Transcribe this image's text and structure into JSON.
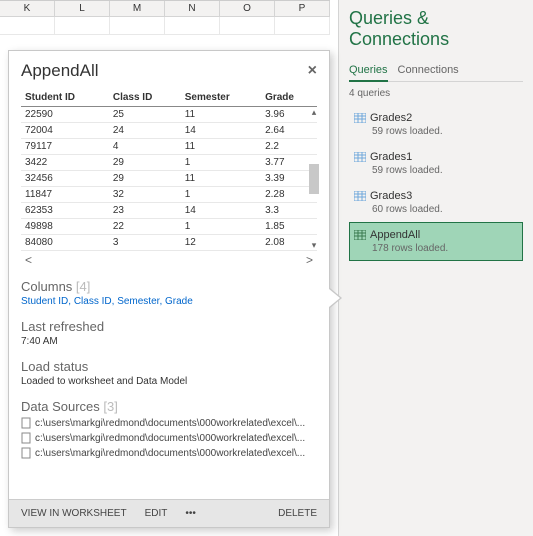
{
  "sheet": {
    "cols": [
      "K",
      "L",
      "M",
      "N",
      "O",
      "P"
    ]
  },
  "panel": {
    "title": "Queries & Connections",
    "tabs": {
      "queries": "Queries",
      "connections": "Connections"
    },
    "count": "4 queries",
    "items": [
      {
        "name": "Grades2",
        "sub": "59 rows loaded."
      },
      {
        "name": "Grades1",
        "sub": "59 rows loaded."
      },
      {
        "name": "Grades3",
        "sub": "60 rows loaded."
      },
      {
        "name": "AppendAll",
        "sub": "178 rows loaded."
      }
    ]
  },
  "popup": {
    "title": "AppendAll",
    "headers": [
      "Student ID",
      "Class ID",
      "Semester",
      "Grade"
    ],
    "rows": [
      [
        "22590",
        "25",
        "11",
        "3.96"
      ],
      [
        "72004",
        "24",
        "14",
        "2.64"
      ],
      [
        "79117",
        "4",
        "11",
        "2.2"
      ],
      [
        "3422",
        "29",
        "1",
        "3.77"
      ],
      [
        "32456",
        "29",
        "11",
        "3.39"
      ],
      [
        "11847",
        "32",
        "1",
        "2.28"
      ],
      [
        "62353",
        "23",
        "14",
        "3.3"
      ],
      [
        "49898",
        "22",
        "1",
        "1.85"
      ],
      [
        "84080",
        "3",
        "12",
        "2.08"
      ]
    ],
    "columns_h": "Columns",
    "columns_n": "[4]",
    "columns_list": [
      "Student ID",
      "Class ID",
      "Semester",
      "Grade"
    ],
    "refreshed_h": "Last refreshed",
    "refreshed_v": "7:40 AM",
    "status_h": "Load status",
    "status_v": "Loaded to worksheet and Data Model",
    "sources_h": "Data Sources",
    "sources_n": "[3]",
    "sources": [
      "c:\\users\\markgi\\redmond\\documents\\000workrelated\\excel\\...",
      "c:\\users\\markgi\\redmond\\documents\\000workrelated\\excel\\...",
      "c:\\users\\markgi\\redmond\\documents\\000workrelated\\excel\\..."
    ],
    "footer": {
      "view": "VIEW IN WORKSHEET",
      "edit": "EDIT",
      "more": "•••",
      "delete": "DELETE"
    }
  }
}
